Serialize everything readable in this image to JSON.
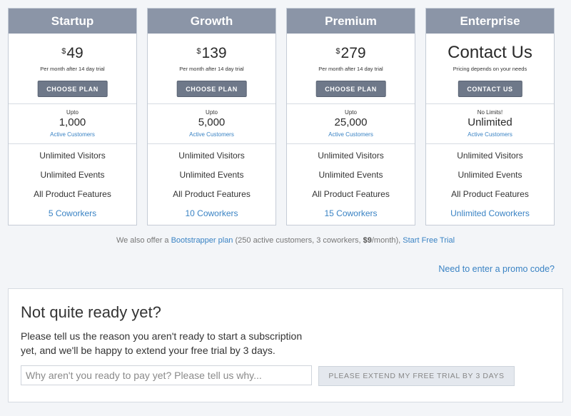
{
  "plans": [
    {
      "name": "Startup",
      "currency": "$",
      "price": "49",
      "price_sub": "Per month after 14 day trial",
      "button": "CHOOSE PLAN",
      "upto": "Upto",
      "customers": "1,000",
      "customers_label": "Active Customers",
      "features": [
        "Unlimited Visitors",
        "Unlimited Events",
        "All Product Features"
      ],
      "coworkers": "5 Coworkers"
    },
    {
      "name": "Growth",
      "currency": "$",
      "price": "139",
      "price_sub": "Per month after 14 day trial",
      "button": "CHOOSE PLAN",
      "upto": "Upto",
      "customers": "5,000",
      "customers_label": "Active Customers",
      "features": [
        "Unlimited Visitors",
        "Unlimited Events",
        "All Product Features"
      ],
      "coworkers": "10 Coworkers"
    },
    {
      "name": "Premium",
      "currency": "$",
      "price": "279",
      "price_sub": "Per month after 14 day trial",
      "button": "CHOOSE PLAN",
      "upto": "Upto",
      "customers": "25,000",
      "customers_label": "Active Customers",
      "features": [
        "Unlimited Visitors",
        "Unlimited Events",
        "All Product Features"
      ],
      "coworkers": "15 Coworkers"
    },
    {
      "name": "Enterprise",
      "price": "Contact Us",
      "price_sub": "Pricing depends on your needs",
      "button": "CONTACT US",
      "upto": "No Limits!",
      "customers": "Unlimited",
      "customers_label": "Active Customers",
      "features": [
        "Unlimited Visitors",
        "Unlimited Events",
        "All Product Features"
      ],
      "coworkers": "Unlimited Coworkers"
    }
  ],
  "bootstrapper": {
    "prefix": "We also offer a ",
    "plan_link": "Bootstrapper plan",
    "middle": " (250 active customers, 3 coworkers, ",
    "price": "$9",
    "suffix": "/month), ",
    "trial_link": "Start Free Trial"
  },
  "promo_link": "Need to enter a promo code?",
  "not_ready": {
    "title": "Not quite ready yet?",
    "description": "Please tell us the reason you aren't ready to start a subscription yet, and we'll be happy to extend your free trial by 3 days.",
    "input_placeholder": "Why aren't you ready to pay yet? Please tell us why...",
    "button": "PLEASE EXTEND MY FREE TRIAL BY 3 DAYS"
  },
  "colors": {
    "header_bg": "#8b95a7",
    "button_bg": "#6e7889",
    "link": "#3a83c4",
    "page_bg": "#f3f5f8"
  }
}
